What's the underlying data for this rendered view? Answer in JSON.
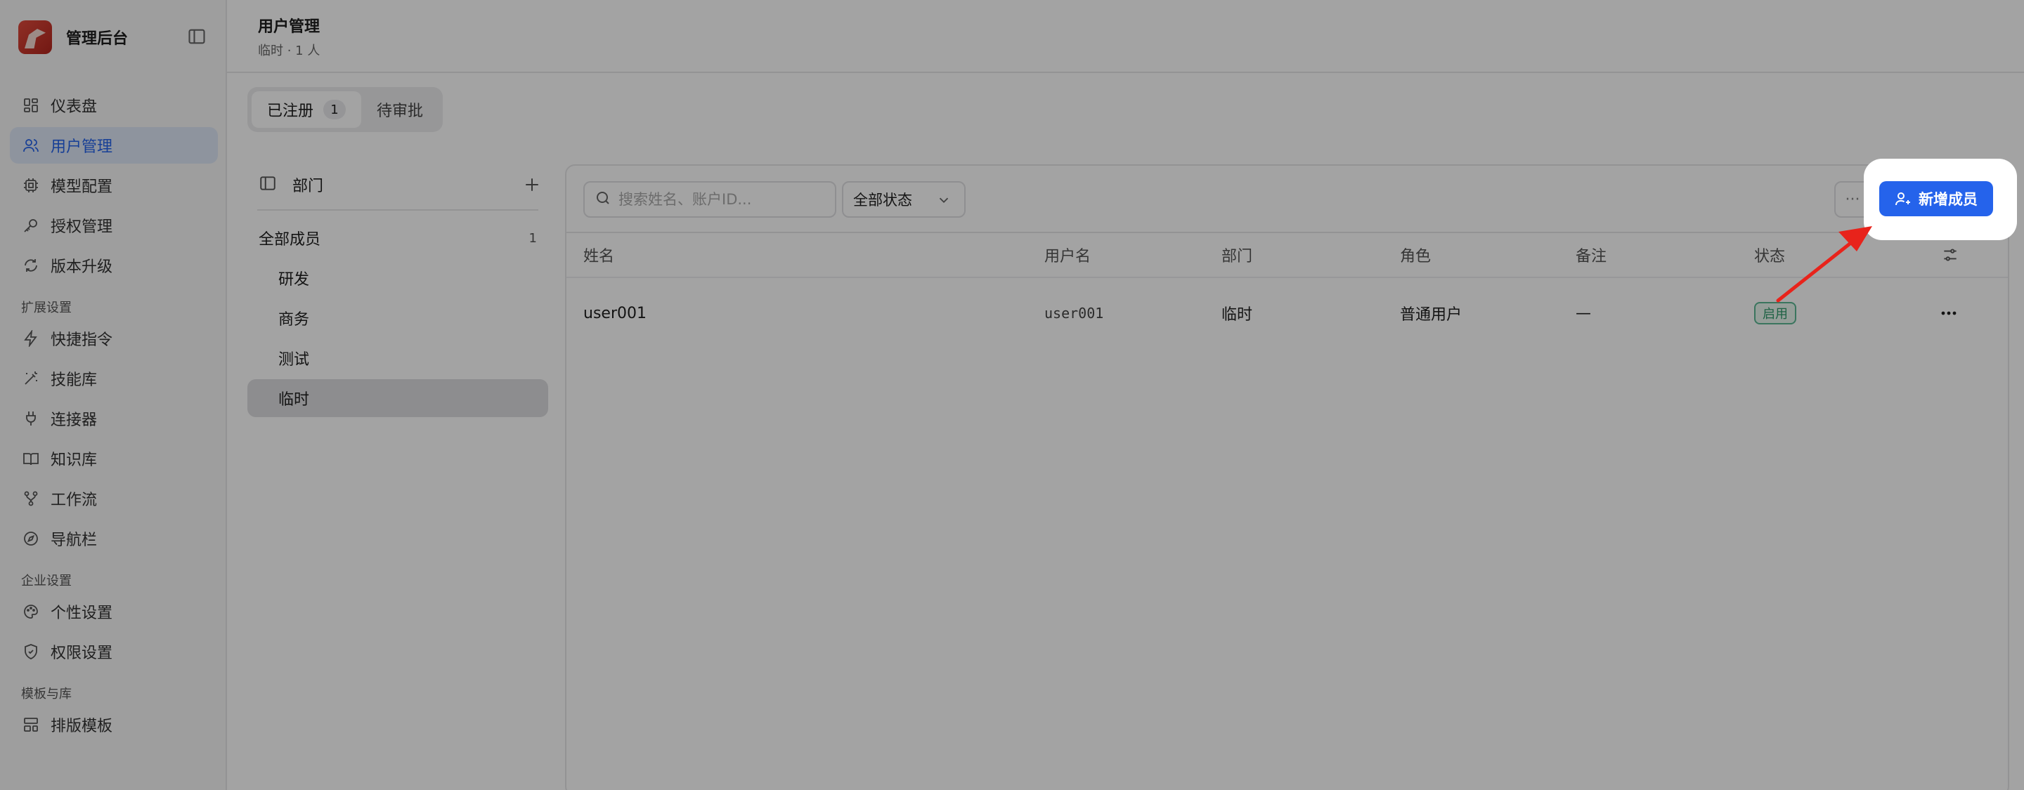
{
  "sidebar": {
    "brand": "管理后台",
    "items": [
      {
        "label": "仪表盘",
        "icon": "dashboard-icon"
      },
      {
        "label": "用户管理",
        "icon": "users-icon",
        "active": true
      },
      {
        "label": "模型配置",
        "icon": "chip-icon"
      },
      {
        "label": "授权管理",
        "icon": "key-icon"
      },
      {
        "label": "版本升级",
        "icon": "refresh-icon"
      }
    ],
    "section_extend": "扩展设置",
    "extend_items": [
      {
        "label": "快捷指令",
        "icon": "bolt-icon"
      },
      {
        "label": "技能库",
        "icon": "magic-wand-icon"
      },
      {
        "label": "连接器",
        "icon": "plug-icon"
      },
      {
        "label": "知识库",
        "icon": "book-icon"
      },
      {
        "label": "工作流",
        "icon": "workflow-icon"
      },
      {
        "label": "导航栏",
        "icon": "compass-icon"
      }
    ],
    "section_enterprise": "企业设置",
    "enterprise_items": [
      {
        "label": "个性设置",
        "icon": "palette-icon"
      },
      {
        "label": "权限设置",
        "icon": "shield-icon"
      }
    ],
    "section_templates": "模板与库",
    "template_items": [
      {
        "label": "排版模板",
        "icon": "layout-icon"
      }
    ]
  },
  "header": {
    "title": "用户管理",
    "subtitle": "临时 · 1 人"
  },
  "tabs": [
    {
      "label": "已注册",
      "count": "1",
      "active": true
    },
    {
      "label": "待审批"
    }
  ],
  "departments": {
    "title": "部门",
    "all_label": "全部成员",
    "all_count": "1",
    "items": [
      "研发",
      "商务",
      "测试",
      "临时"
    ],
    "selected": "临时"
  },
  "toolbar": {
    "search_placeholder": "搜索姓名、账户ID...",
    "status_filter": "全部状态",
    "more": "···",
    "add_button": "新增成员"
  },
  "table": {
    "columns": [
      "姓名",
      "用户名",
      "部门",
      "角色",
      "备注",
      "状态"
    ],
    "rows": [
      {
        "name": "user001",
        "username": "user001",
        "dept": "临时",
        "role": "普通用户",
        "note": "—",
        "status": "启用"
      }
    ]
  },
  "colors": {
    "accent": "#2563eb",
    "status_green": "#2f9a6b",
    "arrow_red": "#e8231b"
  }
}
